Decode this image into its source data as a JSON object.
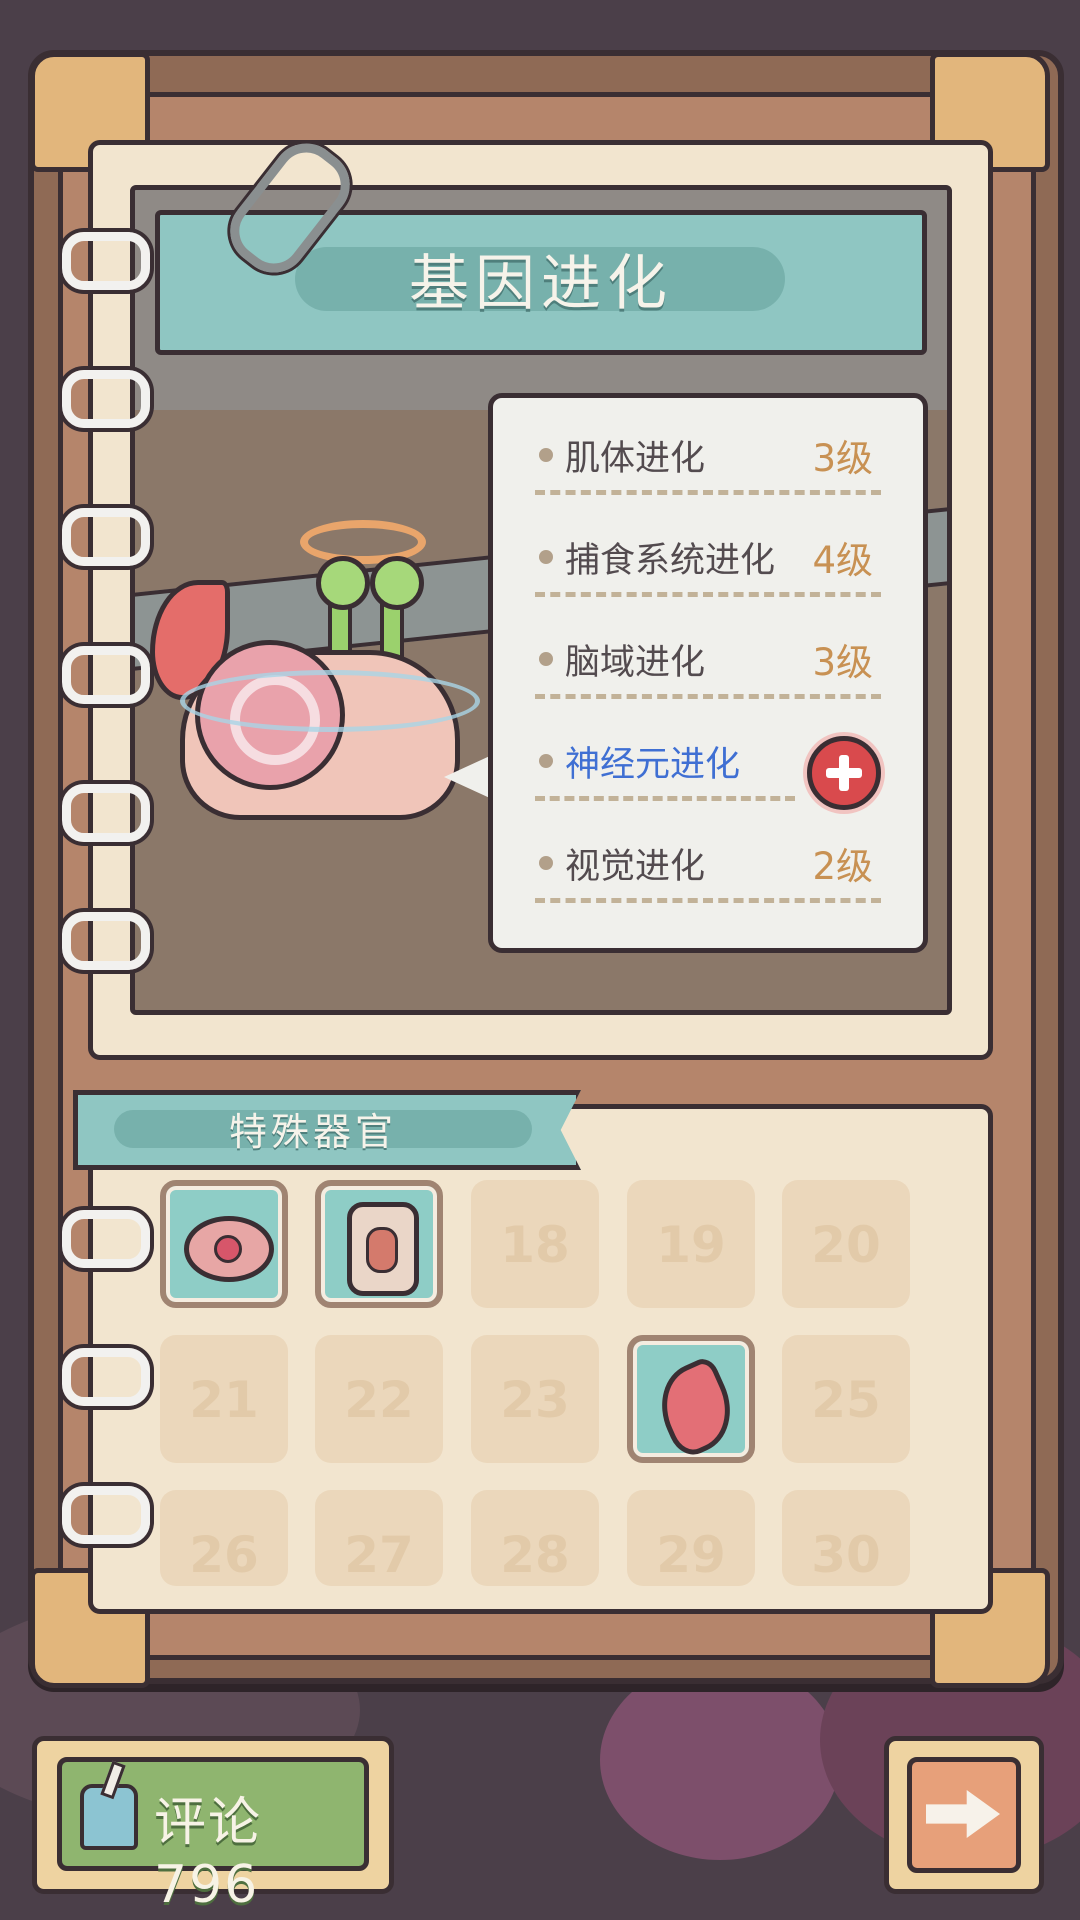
{
  "title": "基因进化",
  "evolution_items": [
    {
      "name": "肌体进化",
      "level": "3级",
      "active": false
    },
    {
      "name": "捕食系统进化",
      "level": "4级",
      "active": false
    },
    {
      "name": "脑域进化",
      "level": "3级",
      "active": false
    },
    {
      "name": "神经元进化",
      "level": "",
      "active": true
    },
    {
      "name": "视觉进化",
      "level": "2级",
      "active": false
    }
  ],
  "organs_section": {
    "title": "特殊器官",
    "slots": [
      {
        "label": "",
        "icon": "eye-organ-icon",
        "filled": true
      },
      {
        "label": "",
        "icon": "cylinder-organ-icon",
        "filled": true
      },
      {
        "label": "18",
        "filled": false
      },
      {
        "label": "19",
        "filled": false
      },
      {
        "label": "20",
        "filled": false
      },
      {
        "label": "21",
        "filled": false
      },
      {
        "label": "22",
        "filled": false
      },
      {
        "label": "23",
        "filled": false
      },
      {
        "label": "",
        "icon": "wing-organ-icon",
        "filled": true
      },
      {
        "label": "25",
        "filled": false
      },
      {
        "label": "26",
        "filled": false
      },
      {
        "label": "27",
        "filled": false
      },
      {
        "label": "28",
        "filled": false
      },
      {
        "label": "29",
        "filled": false
      },
      {
        "label": "30",
        "filled": false
      }
    ]
  },
  "comment_button": {
    "label": "评论 796",
    "icon": "inkwell-icon"
  },
  "next_button": {
    "icon": "arrow-right-icon"
  },
  "colors": {
    "accent_teal": "#8fc6c2",
    "level_text": "#c89153",
    "active_text": "#3f6fd3",
    "plus_red": "#d94a4d"
  }
}
